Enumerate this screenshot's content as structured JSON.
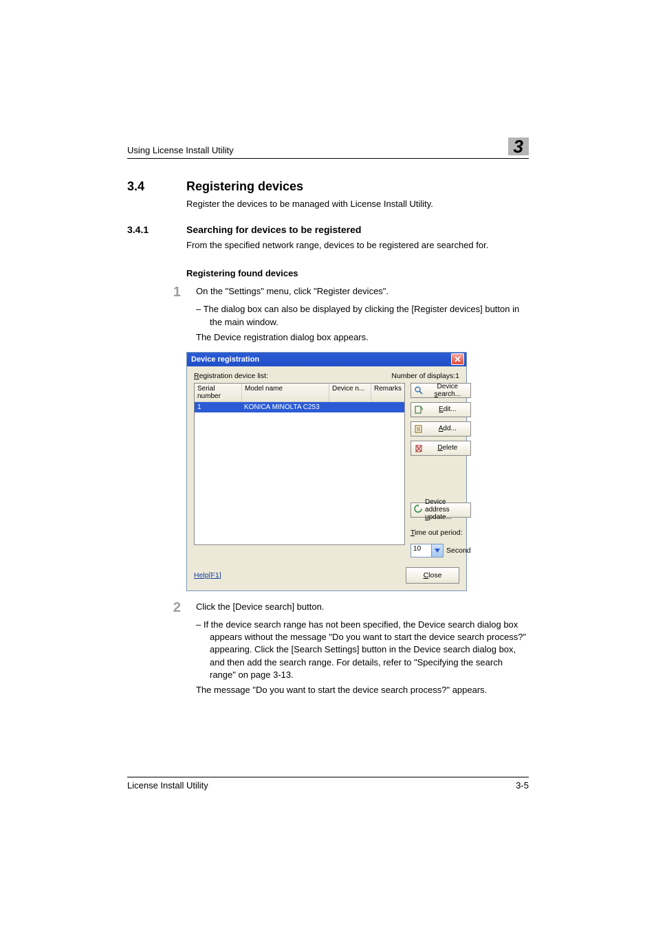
{
  "header": {
    "running_head": "Using License Install Utility",
    "chapter_number": "3"
  },
  "section": {
    "number": "3.4",
    "title": "Registering devices",
    "intro": "Register the devices to be managed with License Install Utility."
  },
  "subsection": {
    "number": "3.4.1",
    "title": "Searching for devices to be registered",
    "intro": "From the specified network range, devices to be registered are searched for."
  },
  "subhead": "Registering found devices",
  "step1": {
    "num": "1",
    "text": "On the \"Settings\" menu, click \"Register devices\".",
    "bullet": "–   The dialog box can also be displayed by clicking the [Register devices] button in the main window.",
    "after": "The Device registration dialog box appears."
  },
  "dialog": {
    "title": "Device registration",
    "list_label_pre": "R",
    "list_label_rest": "egistration device list:",
    "displays_label": "Number of displays:1",
    "columns": {
      "serial": "Serial number",
      "model": "Model name",
      "devicen": "Device n...",
      "remarks": "Remarks"
    },
    "row": {
      "serial": "1",
      "model": "KONICA MINOLTA C253"
    },
    "buttons": {
      "search_pre": "Device ",
      "search_u": "s",
      "search_post": "earch...",
      "edit_u": "E",
      "edit_post": "dit...",
      "add_u": "A",
      "add_post": "dd...",
      "delete_u": "D",
      "delete_post": "elete",
      "update_pre": "Device address ",
      "update_u": "u",
      "update_post": "pdate..."
    },
    "timeout_label_u": "T",
    "timeout_label_rest": "ime out period:",
    "timeout_value": "10",
    "timeout_unit": "Second",
    "help": "Help[F1]",
    "close_u": "C",
    "close_rest": "lose"
  },
  "step2": {
    "num": "2",
    "text": "Click the [Device search] button.",
    "bullet": "–   If the device search range has not been specified, the Device search dialog box appears without the message \"Do you want to start the device search process?\" appearing. Click the [Search Settings] button in the Device search dialog box, and then add the search range. For details, refer to \"Specifying the search range\" on page 3-13.",
    "after": "The message \"Do you want to start the device search process?\" appears."
  },
  "footer": {
    "left": "License Install Utility",
    "right": "3-5"
  }
}
